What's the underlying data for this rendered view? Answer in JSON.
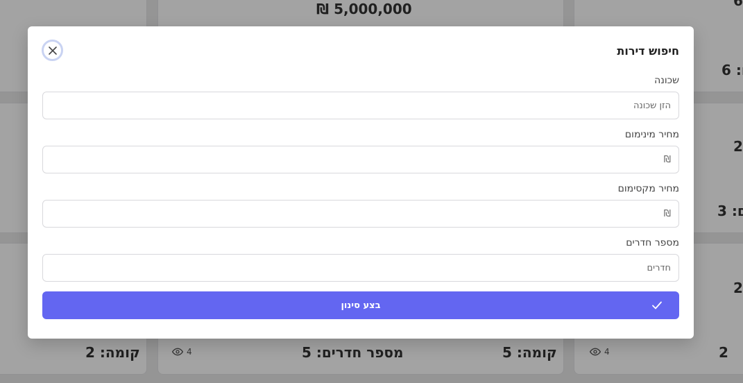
{
  "background": {
    "top_price": "5,000,000 ₪",
    "card_right_top_digit": "6",
    "card_right_top_rooms": "ם: 6",
    "card_right_mid_digit": "2",
    "card_right_mid_rooms": "ם: 3",
    "card_right_bottom_digit": "2",
    "card_right_bottom_value": "2",
    "card_right_bottom_views": "4",
    "card_mid_bottom_rooms": "מספר חדרים: 5",
    "card_mid_bottom_floor": "קומה: 5",
    "card_mid_bottom_views": "4",
    "card_left_bottom_floor": "קומה: 2"
  },
  "modal": {
    "title": "חיפוש דירות",
    "fields": [
      {
        "label": "שכונה",
        "placeholder": "הזן שכונה",
        "value": ""
      },
      {
        "label": "מחיר מינימום",
        "placeholder": "₪",
        "value": ""
      },
      {
        "label": "מחיר מקסימום",
        "placeholder": "₪",
        "value": ""
      },
      {
        "label": "מספר חדרים",
        "placeholder": "חדרים",
        "value": ""
      }
    ],
    "submit_label": "בצע סינון"
  },
  "colors": {
    "accent": "#6366f1",
    "close_ring": "#c9d3f2"
  },
  "icons": {
    "close": "close-icon",
    "check": "check-icon",
    "views": "eye-icon"
  }
}
